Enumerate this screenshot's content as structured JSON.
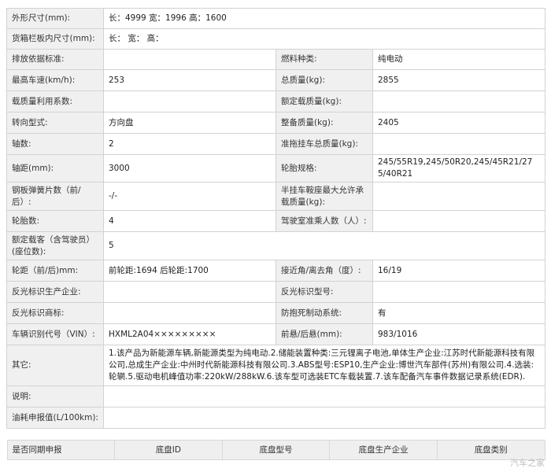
{
  "rows": [
    {
      "k1": "外形尺寸(mm):",
      "v1": "长：4999 宽：1996 高：1600",
      "span": true
    },
    {
      "k1": "货箱栏板内尺寸(mm):",
      "v1": "长：  宽：  高：",
      "span": true
    },
    {
      "k1": "排放依据标准:",
      "v1": "",
      "k2": "燃料种类:",
      "v2": "纯电动"
    },
    {
      "k1": "最高车速(km/h):",
      "v1": "253",
      "k2": "总质量(kg):",
      "v2": "2855"
    },
    {
      "k1": "载质量利用系数:",
      "v1": "",
      "k2": "额定载质量(kg):",
      "v2": ""
    },
    {
      "k1": "转向型式:",
      "v1": "方向盘",
      "k2": "整备质量(kg):",
      "v2": "2405"
    },
    {
      "k1": "轴数:",
      "v1": "2",
      "k2": "准拖挂车总质量(kg):",
      "v2": ""
    },
    {
      "k1": "轴距(mm):",
      "v1": "3000",
      "k2": "轮胎规格:",
      "v2": "245/55R19,245/50R20,245/45R21/275/40R21"
    },
    {
      "k1": "钢板弹簧片数（前/后）:",
      "v1": "-/-",
      "k2": "半挂车鞍座最大允许承载质量(kg):",
      "v2": ""
    },
    {
      "k1": "轮胎数:",
      "v1": "4",
      "k2": "驾驶室准乘人数（人）:",
      "v2": ""
    },
    {
      "k1": "额定载客（含驾驶员）(座位数):",
      "v1": "5",
      "span": true
    },
    {
      "k1": "轮距（前/后)mm:",
      "v1": "前轮距:1694 后轮距:1700",
      "k2": "接近角/离去角（度）:",
      "v2": "16/19"
    },
    {
      "k1": "反光标识生产企业:",
      "v1": "",
      "k2": "反光标识型号:",
      "v2": ""
    },
    {
      "k1": "反光标识商标:",
      "v1": "",
      "k2": "防抱死制动系统:",
      "v2": "有"
    },
    {
      "k1": "车辆识别代号（VIN）:",
      "v1": "HXML2A04×××××××××",
      "k2": "前悬/后悬(mm):",
      "v2": "983/1016"
    },
    {
      "k1": "其它:",
      "v1": "1.该产品为新能源车辆,新能源类型为纯电动.2.储能装置种类:三元锂离子电池,单体生产企业:江苏时代新能源科技有限公司,总成生产企业:中州时代新能源科技有限公司.3.ABS型号:ESP10,生产企业:博世汽车部件(苏州)有限公司.4.选装:轮辋.5.驱动电机峰值功率:220kW/288kW.6.该车型可选装ETC车载装置.7.该车配备汽车事件数据记录系统(EDR).",
      "span": true
    },
    {
      "k1": "说明:",
      "v1": "",
      "span": true
    },
    {
      "k1": "油耗申报值(L/100km):",
      "v1": "",
      "span": true
    }
  ],
  "chassis_header": [
    "是否同期申报",
    "底盘ID",
    "底盘型号",
    "底盘生产企业",
    "底盘类别"
  ],
  "watermark": "汽车之家"
}
